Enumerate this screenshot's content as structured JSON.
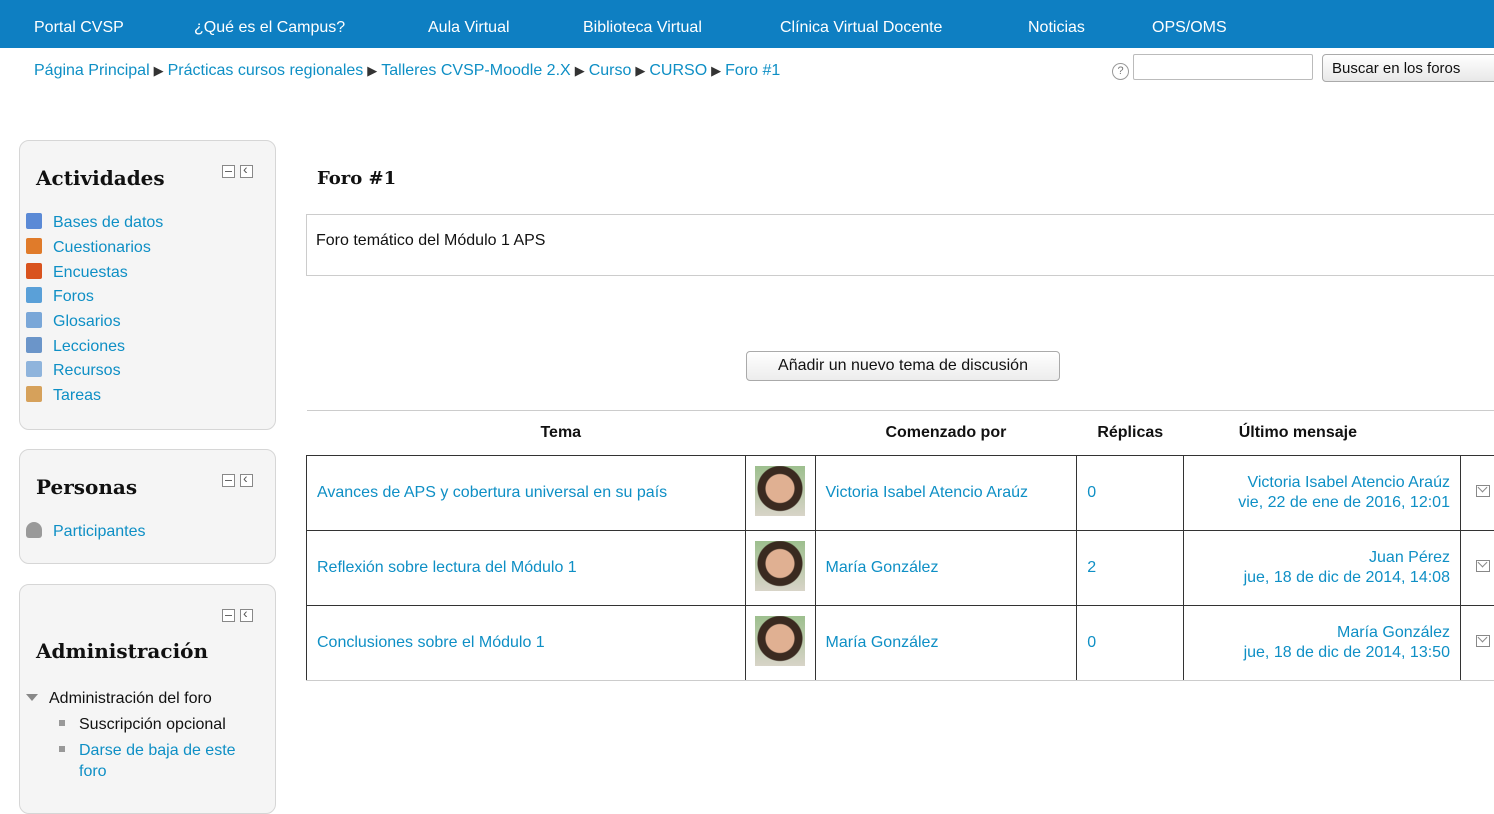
{
  "topnav": {
    "items": [
      "Portal CVSP",
      "¿Qué es el Campus?",
      "Aula Virtual",
      "Biblioteca Virtual",
      "Clínica Virtual Docente",
      "Noticias",
      "OPS/OMS"
    ]
  },
  "breadcrumb": [
    "Página Principal",
    "Prácticas cursos regionales",
    "Talleres CVSP-Moodle 2.X",
    "Curso",
    "CURSO",
    "Foro #1"
  ],
  "search": {
    "help_icon": "?",
    "value": "",
    "button_label": "Buscar en los foros"
  },
  "activities_block": {
    "title": "Actividades",
    "items": [
      {
        "label": "Bases de datos",
        "icon": "database-icon",
        "color": "#5b8ad6"
      },
      {
        "label": "Cuestionarios",
        "icon": "quiz-icon",
        "color": "#e07b2a"
      },
      {
        "label": "Encuestas",
        "icon": "survey-icon",
        "color": "#d9531e"
      },
      {
        "label": "Foros",
        "icon": "forum-icon",
        "color": "#5aa0d8"
      },
      {
        "label": "Glosarios",
        "icon": "glossary-icon",
        "color": "#7aa7d8"
      },
      {
        "label": "Lecciones",
        "icon": "lesson-icon",
        "color": "#6b95c9"
      },
      {
        "label": "Recursos",
        "icon": "resource-icon",
        "color": "#8fb4dc"
      },
      {
        "label": "Tareas",
        "icon": "assignment-icon",
        "color": "#d6a15b"
      }
    ]
  },
  "people_block": {
    "title": "Personas",
    "item": "Participantes"
  },
  "admin_block": {
    "title": "Administración",
    "tree_root": "Administración del foro",
    "items": [
      {
        "label": "Suscripción opcional",
        "link": false
      },
      {
        "label": "Darse de baja de este",
        "link": true
      },
      {
        "label": "foro",
        "link": true
      }
    ]
  },
  "main": {
    "title": "Foro #1",
    "intro": "Foro temático del Módulo 1 APS",
    "add_button": "Añadir un nuevo tema de discusión",
    "table": {
      "headers": [
        "Tema",
        "Comenzado por",
        "Réplicas",
        "Último mensaje"
      ],
      "rows": [
        {
          "topic": "Avances de APS y cobertura universal en su país",
          "author": "Victoria Isabel Atencio Araúz",
          "replies": "0",
          "last_author": "Victoria Isabel Atencio Araúz",
          "last_date": "vie, 22 de ene de 2016, 12:01"
        },
        {
          "topic": "Reflexión sobre lectura del Módulo 1",
          "author": "María González",
          "replies": "2",
          "last_author": "Juan Pérez",
          "last_date": "jue, 18 de dic de 2014, 14:08"
        },
        {
          "topic": "Conclusiones sobre el Módulo 1",
          "author": "María González",
          "replies": "0",
          "last_author": "María González",
          "last_date": "jue, 18 de dic de 2014, 13:50"
        }
      ]
    }
  },
  "colors": {
    "nav_bg": "#0e7fc2",
    "link": "#0e8fc5"
  }
}
